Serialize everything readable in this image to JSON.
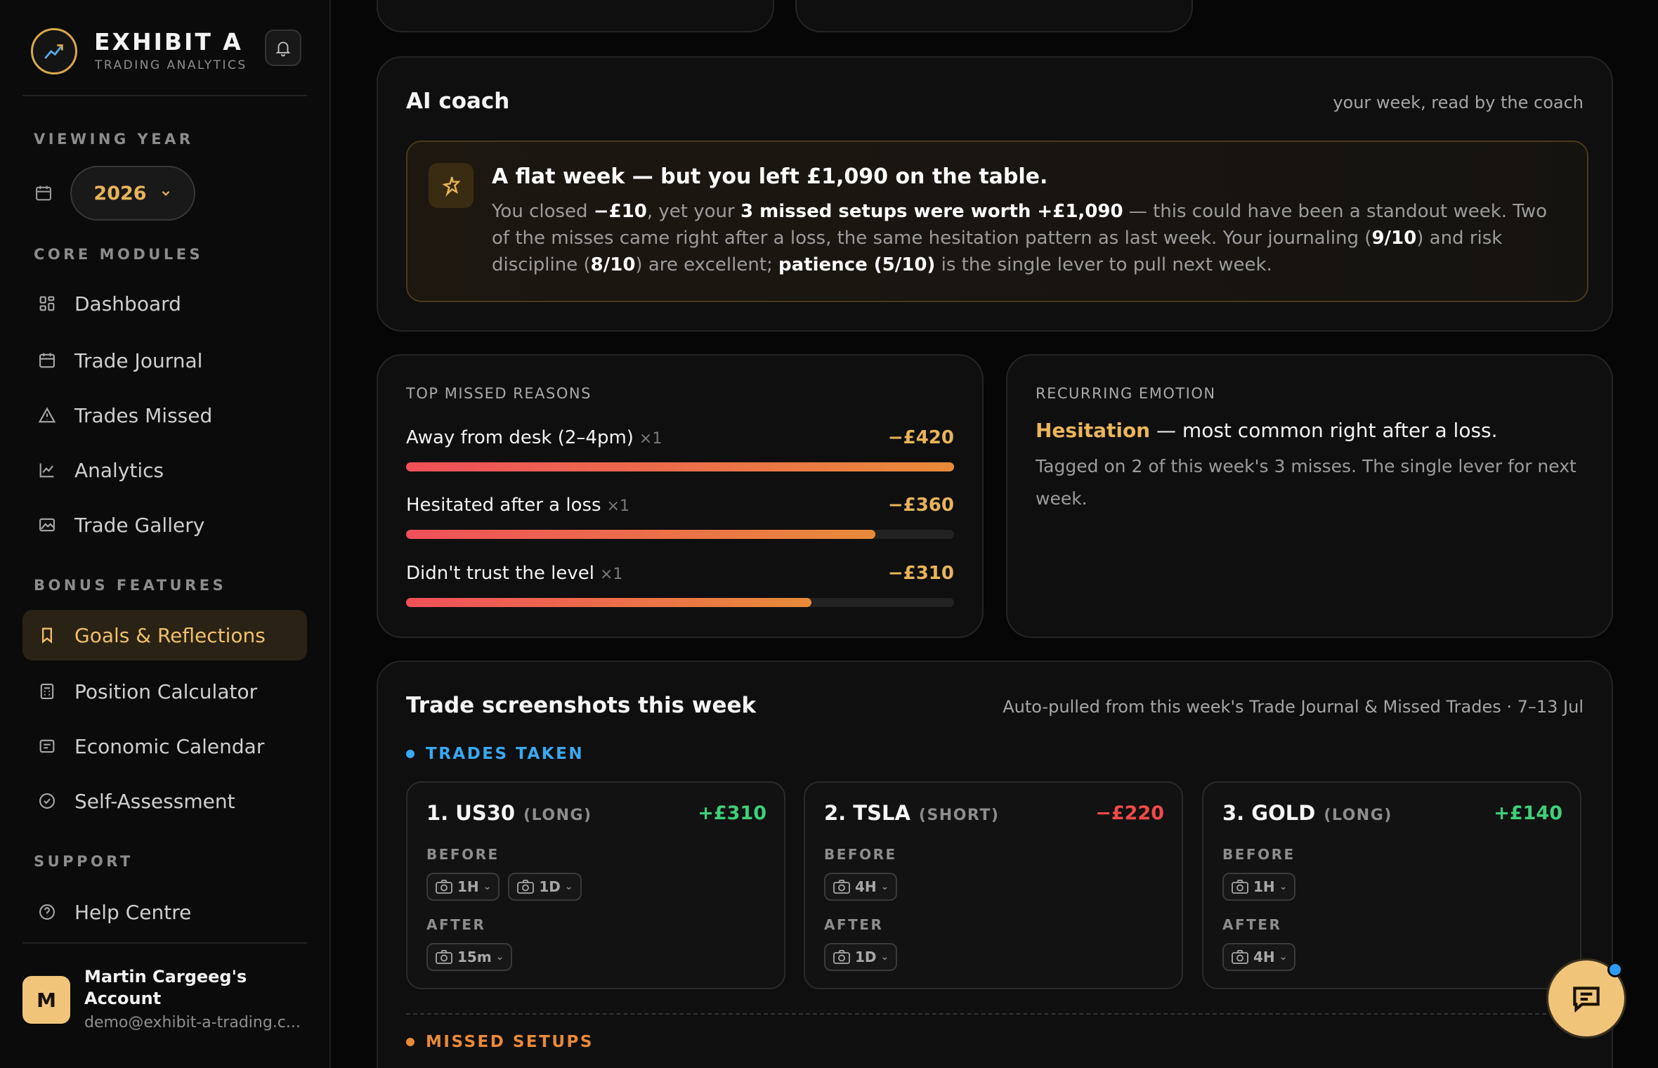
{
  "brand": {
    "name": "EXHIBIT A",
    "tagline": "TRADING ANALYTICS"
  },
  "sidebar": {
    "viewing_year_label": "VIEWING YEAR",
    "year": "2026",
    "core_label": "CORE MODULES",
    "core_items": [
      {
        "label": "Dashboard",
        "icon": "grid-icon"
      },
      {
        "label": "Trade Journal",
        "icon": "calendar-icon"
      },
      {
        "label": "Trades Missed",
        "icon": "warning-icon"
      },
      {
        "label": "Analytics",
        "icon": "line-chart-icon"
      },
      {
        "label": "Trade Gallery",
        "icon": "image-icon"
      }
    ],
    "bonus_label": "BONUS FEATURES",
    "bonus_items": [
      {
        "label": "Goals & Reflections",
        "icon": "bookmark-icon",
        "active": true
      },
      {
        "label": "Position Calculator",
        "icon": "calculator-icon"
      },
      {
        "label": "Economic Calendar",
        "icon": "news-icon"
      },
      {
        "label": "Self-Assessment",
        "icon": "check-circle-icon"
      }
    ],
    "support_label": "SUPPORT",
    "support_items": [
      {
        "label": "Help Centre",
        "icon": "help-icon"
      }
    ],
    "account": {
      "initial": "M",
      "name": "Martin Cargeeg's Account",
      "email": "demo@exhibit-a-trading.c..."
    }
  },
  "coach": {
    "title": "AI coach",
    "subtitle": "your week, read by the coach",
    "headline": "A flat week — but you left £1,090 on the table.",
    "p1": "You closed ",
    "b1": "−£10",
    "p2": ", yet your ",
    "b2": "3 missed setups were worth +£1,090",
    "p3": " — this could have been a standout week. Two of the misses came right after a loss, the same hesitation pattern as last week. Your journaling (",
    "b3": "9/10",
    "p4": ") and risk discipline (",
    "b4": "8/10",
    "p5": ") are excellent; ",
    "b5": "patience (5/10)",
    "p6": " is the single lever to pull next week."
  },
  "missed_reasons": {
    "label": "TOP MISSED REASONS",
    "items": [
      {
        "label": "Away from desk (2–4pm)",
        "count": "×1",
        "value": "−£420",
        "fraction": 1.0
      },
      {
        "label": "Hesitated after a loss",
        "count": "×1",
        "value": "−£360",
        "fraction": 0.857
      },
      {
        "label": "Didn't trust the level",
        "count": "×1",
        "value": "−£310",
        "fraction": 0.74
      }
    ]
  },
  "emotion": {
    "label": "RECURRING EMOTION",
    "highlight": "Hesitation",
    "rest": " — most common right after a loss.",
    "desc": "Tagged on 2 of this week's 3 misses. The single lever for next week."
  },
  "screenshots": {
    "title": "Trade screenshots this week",
    "subtitle": "Auto-pulled from this week's Trade Journal & Missed Trades · 7–13 Jul",
    "taken_label": "TRADES TAKEN",
    "missed_label": "MISSED SETUPS",
    "before_label": "BEFORE",
    "after_label": "AFTER",
    "trades": [
      {
        "title": "1. US30",
        "dir": "(LONG)",
        "pnl": "+£310",
        "positive": true,
        "before": [
          "1H",
          "1D"
        ],
        "after": [
          "15m"
        ]
      },
      {
        "title": "2. TSLA",
        "dir": "(SHORT)",
        "pnl": "−£220",
        "positive": false,
        "before": [
          "4H"
        ],
        "after": [
          "1D"
        ]
      },
      {
        "title": "3. GOLD",
        "dir": "(LONG)",
        "pnl": "+£140",
        "positive": true,
        "before": [
          "1H"
        ],
        "after": [
          "4H"
        ]
      }
    ]
  },
  "colors": {
    "accent": "#e8b45a",
    "positive": "#3fcf7a",
    "negative": "#f04a4a",
    "taken": "#3aa8f0",
    "missed": "#e8893a"
  }
}
